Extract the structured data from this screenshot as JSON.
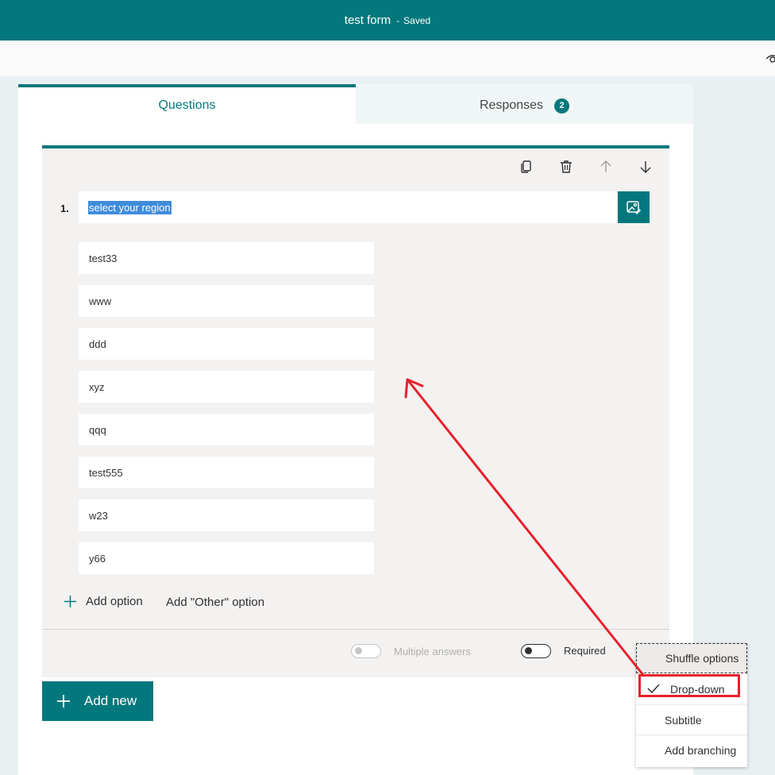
{
  "header": {
    "form_title": "test form",
    "separator": "-",
    "save_status": "Saved"
  },
  "toolbar": {
    "preview_icon": "eye-icon"
  },
  "tabs": [
    {
      "label": "Questions",
      "active": true
    },
    {
      "label": "Responses",
      "badge": "2",
      "active": false
    }
  ],
  "question": {
    "number": "1.",
    "title": "select your region",
    "actions": [
      "copy-icon",
      "trash-icon",
      "arrow-up-icon",
      "arrow-down-icon"
    ],
    "options": [
      "test33",
      "www",
      "ddd",
      "xyz",
      "qqq",
      "test555",
      "w23",
      "y66"
    ],
    "add_option_label": "Add option",
    "add_other_label": "Add \"Other\" option",
    "multiple_answers_label": "Multiple answers",
    "required_label": "Required"
  },
  "add_new_label": "Add new",
  "context_menu": {
    "items": [
      "Shuffle options",
      "Drop-down",
      "Subtitle",
      "Add branching"
    ],
    "checked": "Drop-down"
  },
  "colors": {
    "brand": "#03787c",
    "highlight": "#e8202a",
    "selection": "#3f8cdb"
  }
}
